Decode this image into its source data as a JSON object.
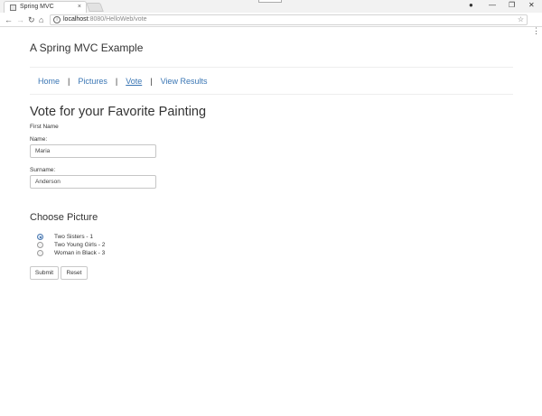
{
  "browser": {
    "tab_title": "Spring MVC",
    "tab_close": "×",
    "url_host": "localhost",
    "url_path": ":8080/HelloWeb/vote",
    "window_controls": [
      "—",
      "❐",
      "✕"
    ],
    "nav_buttons": {
      "back": "←",
      "forward": "→",
      "reload": "↻",
      "home": "⌂"
    },
    "star": "☆",
    "menu": "⋮",
    "profile": "●"
  },
  "page": {
    "brand": "A Spring MVC Example",
    "nav": [
      {
        "label": "Home",
        "active": false
      },
      {
        "label": "Pictures",
        "active": false
      },
      {
        "label": "Vote",
        "active": true
      },
      {
        "label": "View Results",
        "active": false
      }
    ],
    "nav_separator": "|",
    "heading": "Vote for your Favorite Painting",
    "first_name_label": "First Name",
    "name_label": "Name:",
    "name_value": "Maria",
    "surname_label": "Surname:",
    "surname_value": "Anderson",
    "choose_heading": "Choose Picture",
    "pictures": [
      {
        "label": "Two Sisters - 1",
        "checked": true
      },
      {
        "label": "Two Young Girls - 2",
        "checked": false
      },
      {
        "label": "Woman in Black - 3",
        "checked": false
      }
    ],
    "submit_label": "Submit",
    "reset_label": "Reset"
  },
  "colors": {
    "link": "#3a76b4",
    "text": "#333333",
    "radio_checked": "#4a78b0"
  }
}
